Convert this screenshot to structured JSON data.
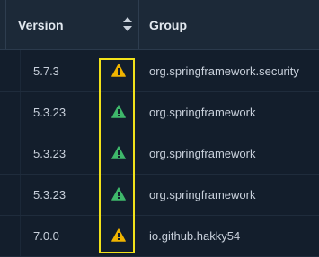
{
  "table": {
    "columns": {
      "version": "Version",
      "group": "Group"
    },
    "sort_icon": "sort-up-down-icon",
    "rows": [
      {
        "version": "5.7.3",
        "group": "org.springframework.security",
        "severity_icon": "warning-triangle-icon",
        "severity_color": "#f0b400"
      },
      {
        "version": "5.3.23",
        "group": "org.springframework",
        "severity_icon": "warning-triangle-icon",
        "severity_color": "#3fb86b"
      },
      {
        "version": "5.3.23",
        "group": "org.springframework",
        "severity_icon": "warning-triangle-icon",
        "severity_color": "#3fb86b"
      },
      {
        "version": "5.3.23",
        "group": "org.springframework",
        "severity_icon": "warning-triangle-icon",
        "severity_color": "#3fb86b"
      },
      {
        "version": "7.0.0",
        "group": "io.github.hakky54",
        "severity_icon": "warning-triangle-icon",
        "severity_color": "#f0b400"
      }
    ]
  },
  "colors": {
    "background": "#131e2c",
    "header_background": "#1c2938",
    "highlight": "#f2e21a",
    "warning_yellow": "#f0b400",
    "warning_green": "#3fb86b"
  }
}
